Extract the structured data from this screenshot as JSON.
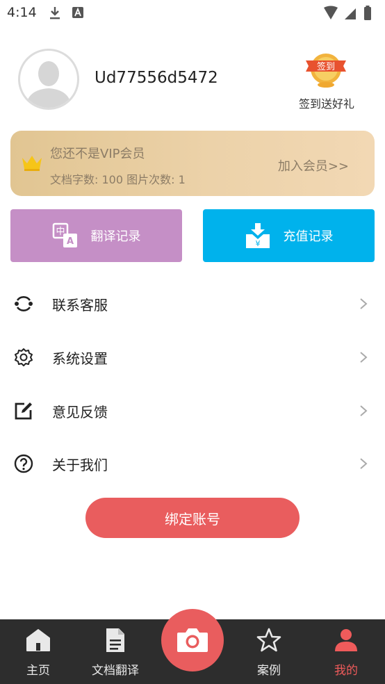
{
  "status_bar": {
    "time": "4:14"
  },
  "profile": {
    "username": "Ud77556d5472",
    "signin_badge": "签到",
    "signin_label": "签到送好礼"
  },
  "vip": {
    "title": "您还不是VIP会员",
    "quota": "文档字数: 100  图片次数: 1",
    "join": "加入会员>>"
  },
  "actions": {
    "translate_records": "翻译记录",
    "recharge_records": "充值记录"
  },
  "menu": [
    {
      "label": "联系客服",
      "icon": "customer-service-icon"
    },
    {
      "label": "系统设置",
      "icon": "gear-icon"
    },
    {
      "label": "意见反馈",
      "icon": "edit-icon"
    },
    {
      "label": "关于我们",
      "icon": "question-icon"
    }
  ],
  "bind_account": "绑定账号",
  "tabs": [
    {
      "label": "主页",
      "icon": "home-icon",
      "active": false
    },
    {
      "label": "文档翻译",
      "icon": "document-icon",
      "active": false
    },
    {
      "label": "案例",
      "icon": "star-icon",
      "active": false
    },
    {
      "label": "我的",
      "icon": "person-icon",
      "active": true
    }
  ],
  "colors": {
    "accent_red": "#e95d5e",
    "translate_purple": "#c58fc6",
    "recharge_blue": "#00b2ec",
    "vip_gold": "#e1c592",
    "tabbar_bg": "#2d2d2d"
  }
}
